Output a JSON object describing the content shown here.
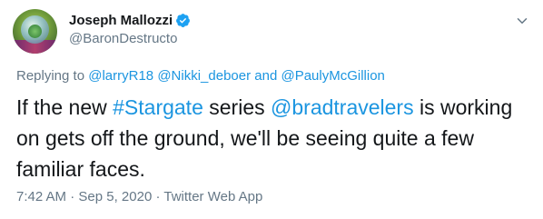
{
  "author": {
    "display_name": "Joseph Mallozzi",
    "handle": "@BaronDestructo"
  },
  "reply_context": {
    "prefix": "Replying to",
    "mentions": [
      "@larryR18",
      "@Nikki_deboer",
      "@PaulyMcGillion"
    ],
    "conjunction": "and"
  },
  "tweet": {
    "part1": "If the new ",
    "hashtag": "#Stargate",
    "part2": " series ",
    "mention": "@bradtravelers",
    "part3": " is working on gets off the ground, we'll be seeing quite a few familiar faces."
  },
  "meta": {
    "time": "7:42 AM",
    "sep": "·",
    "date": "Sep 5, 2020",
    "source": "Twitter Web App"
  },
  "icons": {
    "verified": "verified-badge-icon",
    "menu": "chevron-down-icon"
  },
  "colors": {
    "link": "#1b95e0",
    "secondary_text": "#657786",
    "primary_text": "#14171a",
    "verified": "#1da1f2"
  }
}
